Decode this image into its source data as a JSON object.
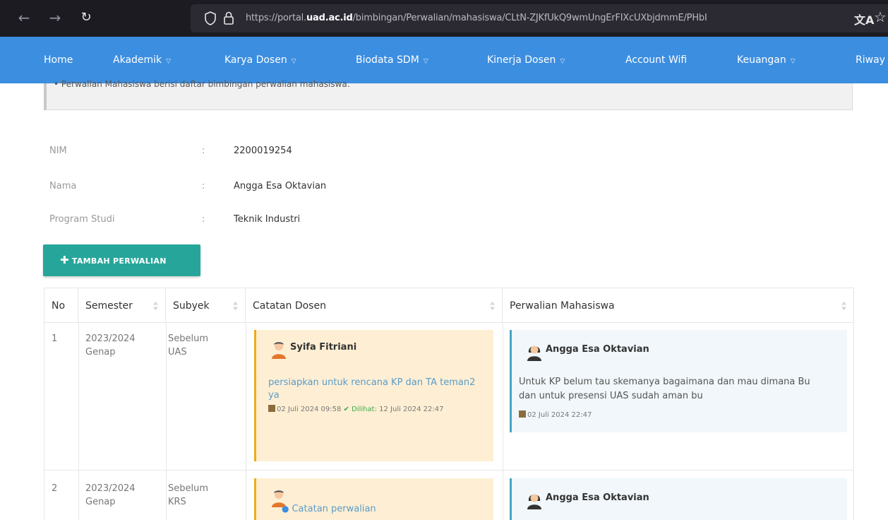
{
  "browser": {
    "url_prefix": "https://portal.",
    "url_host": "uad.ac.id",
    "url_path": "/bimbingan/Perwalian/mahasiswa/CLtN-ZJKfUkQ9wmUngErFIXcUXbjdmmE/PHbI"
  },
  "nav": {
    "items": [
      "Home",
      "Akademik",
      "Karya Dosen",
      "Biodata SDM",
      "Kinerja Dosen",
      "Account Wifi",
      "Keuangan",
      "Riway"
    ]
  },
  "alert": {
    "text": "• Perwalian Mahasiswa berisi daftar bimbingan perwalian mahasiswa."
  },
  "student": {
    "nim_label": "NIM",
    "nim_value": "2200019254",
    "nama_label": "Nama",
    "nama_value": "Angga Esa Oktavian",
    "prodi_label": "Program Studi",
    "prodi_value": "Teknik Industri",
    "colon": ":"
  },
  "add_button": "TAMBAH PERWALIAN",
  "table": {
    "headers": [
      "No",
      "Semester",
      "Subyek",
      "Catatan Dosen",
      "Perwalian Mahasiswa"
    ],
    "rows": [
      {
        "no": "1",
        "semester_1": "2023/2024",
        "semester_2": "Genap",
        "subyek_1": "Sebelum",
        "subyek_2": "UAS",
        "dosen_name": "Syifa Fitriani",
        "dosen_note": "persiapkan untuk rencana KP dan TA teman2 ya",
        "dosen_date": "02 Juli 2024 09:58",
        "seen_label": "Dilihat:",
        "seen_date": "12 Juli 2024 22:47",
        "mhs_name": "Angga Esa Oktavian",
        "mhs_note": "Untuk KP belum tau skemanya bagaimana dan mau dimana Bu dan untuk presensi UAS sudah aman bu",
        "mhs_date": "02 Juli 2024 22:47"
      },
      {
        "no": "2",
        "semester_1": "2023/2024",
        "semester_2": "Genap",
        "subyek_1": "Sebelum",
        "subyek_2": "KRS",
        "dosen_note": "Catatan perwalian",
        "mhs_name": "Angga Esa Oktavian"
      }
    ]
  }
}
